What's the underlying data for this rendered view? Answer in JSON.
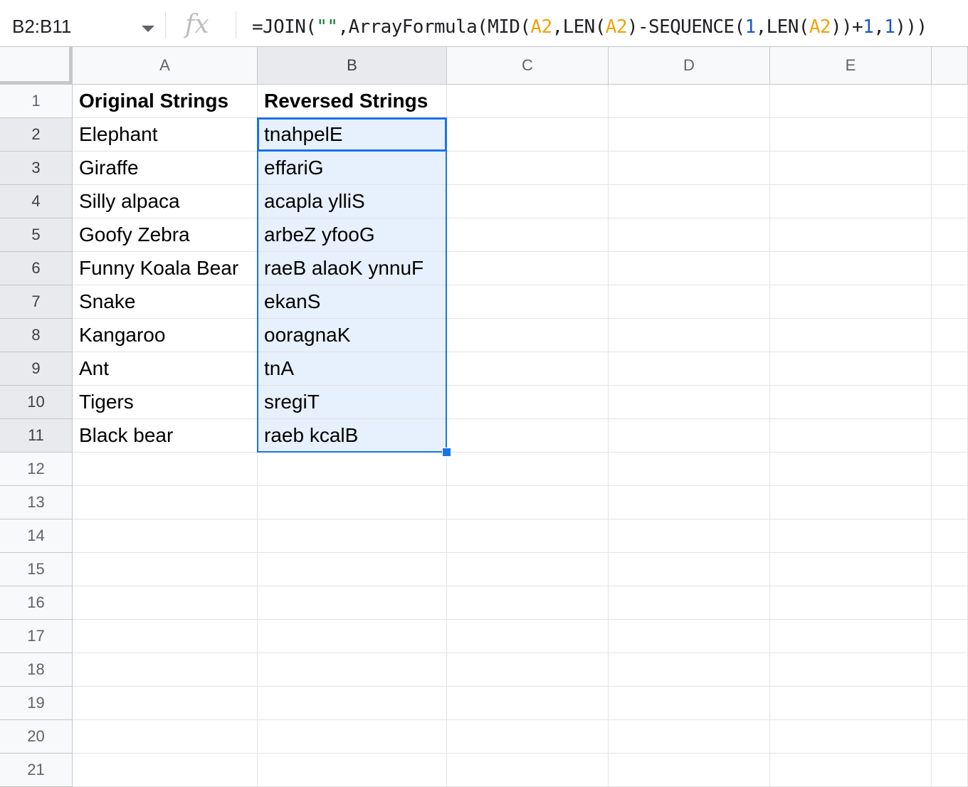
{
  "formula_bar": {
    "name_box": "B2:B11",
    "fx_label": "fx",
    "formula_tokens": [
      {
        "t": "=JOIN(",
        "c": "plain"
      },
      {
        "t": "\"\"",
        "c": "str"
      },
      {
        "t": ",ArrayFormula(MID(",
        "c": "plain"
      },
      {
        "t": "A2",
        "c": "ref"
      },
      {
        "t": ",LEN(",
        "c": "plain"
      },
      {
        "t": "A2",
        "c": "ref"
      },
      {
        "t": ")-SEQUENCE(",
        "c": "plain"
      },
      {
        "t": "1",
        "c": "num"
      },
      {
        "t": ",LEN(",
        "c": "plain"
      },
      {
        "t": "A2",
        "c": "ref"
      },
      {
        "t": "))+",
        "c": "plain"
      },
      {
        "t": "1",
        "c": "num"
      },
      {
        "t": ",",
        "c": "plain"
      },
      {
        "t": "1",
        "c": "num"
      },
      {
        "t": ")))",
        "c": "plain"
      }
    ]
  },
  "columns": [
    "A",
    "B",
    "C",
    "D",
    "E"
  ],
  "rows": [
    "1",
    "2",
    "3",
    "4",
    "5",
    "6",
    "7",
    "8",
    "9",
    "10",
    "11",
    "12",
    "13",
    "14",
    "15",
    "16",
    "17",
    "18",
    "19",
    "20",
    "21"
  ],
  "selection": {
    "range": "B2:B11",
    "column": "B",
    "rows": [
      "2",
      "3",
      "4",
      "5",
      "6",
      "7",
      "8",
      "9",
      "10",
      "11"
    ]
  },
  "cells": {
    "A": [
      "Original Strings",
      "Elephant",
      "Giraffe",
      "Silly alpaca",
      "Goofy Zebra",
      "Funny Koala Bear",
      "Snake",
      "Kangaroo",
      "Ant",
      "Tigers",
      "Black bear"
    ],
    "B": [
      "Reversed Strings",
      "tnahpelE",
      "effariG",
      "acapla ylliS",
      "arbeZ yfooG",
      "raeB alaoK ynnuF",
      "ekanS",
      "ooragnaK",
      "tnA",
      "sregiT",
      "raeb kcalB"
    ]
  },
  "colors": {
    "accent": "#1a73e8",
    "range_fill": "#e7f0fd",
    "string_token": "#0b8043",
    "ref_token": "#f0a30a",
    "number_token": "#1a55c9"
  }
}
